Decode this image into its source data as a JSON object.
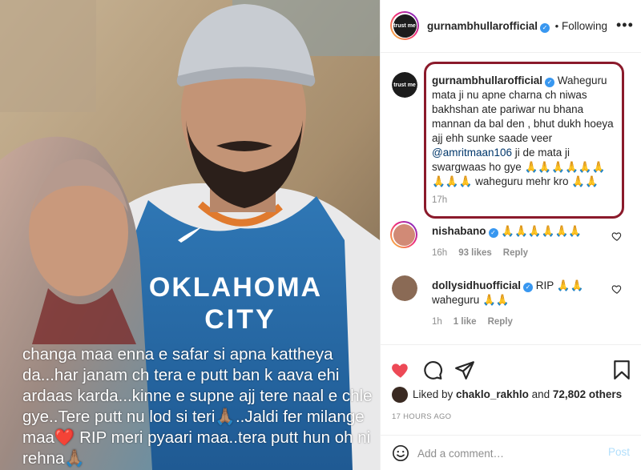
{
  "post": {
    "caption_overlay": "changa maa enna e safar si apna kattheya da...har janam ch tera e putt ban k aava ehi ardaas karda...kinne e supne ajj tere naal e chle gye..Tere putt nu lod si teri🙏🏽..Jaldi fer milange maa❤️ RIP meri pyaari maa..tera putt hun oh ni rehna🙏🏽",
    "jersey_line1": "OKLAHOMA",
    "jersey_line2": "CITY"
  },
  "header": {
    "username": "gurnambhullarofficial",
    "separator": "•",
    "follow_label": "Following",
    "more_label": "•••",
    "avatar_text": "trust me"
  },
  "comments": [
    {
      "username": "gurnambhullarofficial",
      "text_before": "Waheguru mata ji nu apne charna ch niwas bakhshan ate pariwar nu bhana mannan da bal den , bhut dukh hoeya ajj ehh sunke saade veer ",
      "mention": "@amritmaan106",
      "text_after": " ji de mata ji swargwaas ho gye 🙏🙏🙏🙏🙏🙏🙏🙏🙏 waheguru mehr kro 🙏🙏",
      "time": "17h",
      "avatar_text": "trust me"
    },
    {
      "username": "nishabano",
      "text": "🙏🙏🙏🙏🙏🙏",
      "time": "16h",
      "likes": "93 likes",
      "reply": "Reply"
    },
    {
      "username": "dollysidhuofficial",
      "text": "RIP 🙏🙏 waheguru 🙏🙏",
      "time": "1h",
      "likes": "1 like",
      "reply": "Reply"
    }
  ],
  "footer": {
    "liked_prefix": "Liked by ",
    "liked_user": "chaklo_rakhlo",
    "liked_middle": " and ",
    "liked_count": "72,802 others",
    "date": "17 HOURS AGO",
    "comment_placeholder": "Add a comment…",
    "post_label": "Post"
  },
  "icons": {
    "like": "heart-filled-icon",
    "comment": "comment-bubble-icon",
    "share": "paper-plane-icon",
    "save": "bookmark-icon",
    "emoji": "smiley-icon",
    "verified": "verified-check-icon",
    "comment_like": "heart-outline-icon"
  },
  "colors": {
    "like_red": "#ed4956",
    "verified_blue": "#3897f0",
    "highlight_border": "#8b1a2b",
    "post_disabled": "#b2dffc"
  }
}
